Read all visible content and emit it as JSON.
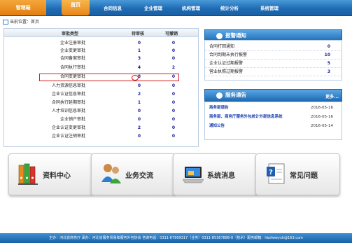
{
  "nav": {
    "brand": "管理端",
    "home": "首页",
    "items": [
      "合同信息",
      "企业管理",
      "机构管理",
      "统计分析",
      "系统管理"
    ]
  },
  "breadcrumb": "当前位置：首页",
  "audit_table": {
    "headers": [
      "审批类型",
      "待审核",
      "可撤销"
    ],
    "rows": [
      {
        "type": "企业注册审批",
        "pending": "0",
        "revocable": "0"
      },
      {
        "type": "企业变更审批",
        "pending": "1",
        "revocable": "0"
      },
      {
        "type": "合同备案审批",
        "pending": "3",
        "revocable": "0"
      },
      {
        "type": "合同执行审批",
        "pending": "4",
        "revocable": "2"
      },
      {
        "type": "合同变更审批",
        "pending": "8",
        "revocable": "0"
      },
      {
        "type": "人力资源信息审批",
        "pending": "0",
        "revocable": "0"
      },
      {
        "type": "企业认证信息审批",
        "pending": "2",
        "revocable": "0"
      },
      {
        "type": "合同执行延期审批",
        "pending": "1",
        "revocable": "0"
      },
      {
        "type": "人才培训信息审批",
        "pending": "0",
        "revocable": "0"
      },
      {
        "type": "企业销户审批",
        "pending": "0",
        "revocable": "0"
      },
      {
        "type": "企业认证变更审批",
        "pending": "2",
        "revocable": "0"
      },
      {
        "type": "企业认证注销审批",
        "pending": "0",
        "revocable": "0"
      }
    ]
  },
  "alarm": {
    "title": "报警通知",
    "rows": [
      {
        "label": "合同打回通知",
        "value": "0"
      },
      {
        "label": "合同到期未执行报警",
        "value": "10"
      },
      {
        "label": "企业认证过期报警",
        "value": "5"
      },
      {
        "label": "营业执照过期报警",
        "value": "3"
      }
    ]
  },
  "notice": {
    "title": "服务通告",
    "more": "更多...",
    "rows": [
      {
        "title": "商务部通告",
        "date": "2016-05-16"
      },
      {
        "title": "商务部、商务厅服务外包统计外部信息系统",
        "date": "2016-05-16"
      },
      {
        "title": "通知公告",
        "date": "2016-05-14"
      }
    ]
  },
  "tiles": [
    {
      "label": "资料中心",
      "icon": "binders-icon"
    },
    {
      "label": "业务交流",
      "icon": "users-icon"
    },
    {
      "label": "系统消息",
      "icon": "laptop-icon"
    },
    {
      "label": "常见问题",
      "icon": "help-document-icon"
    }
  ],
  "footer": "主办：河北省商务厅 承办：河北省服务贸易和服务外包协会 咨询电话：0311-87909317（业务）0311-85367888-0（技术）服务邮箱：hbsfwwyxh@163.com"
}
